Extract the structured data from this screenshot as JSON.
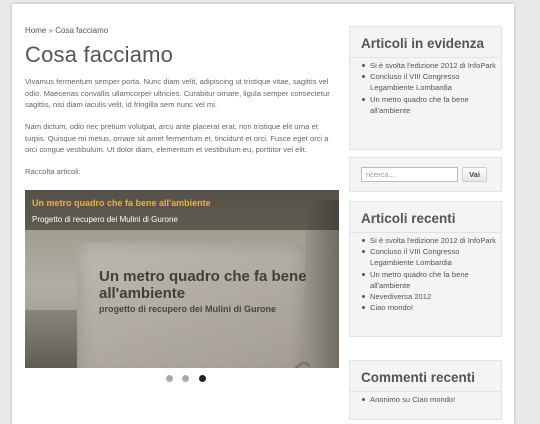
{
  "breadcrumb": {
    "home": "Home",
    "separator": "»",
    "current": "Cosa facciamo"
  },
  "main": {
    "title": "Cosa facciamo",
    "paragraphs": [
      "Vivamus fermentum semper porta. Nunc diam velit, adipiscing ut tristique vitae, sagittis vel odio. Maecenas convallis ullamcorper ultricies. Curabitur ornare, ligula semper consectetur sagittis, nisi diam iaculis velit, id fringilla sem nunc vel mi.",
      "Nam dictum, odio nec pretium volutpat, arcu ante placerat erat, non tristique elit urna et turpis. Quisque mi metus, ornare sit amet fermentum et, tincidunt et orci. Fusce eget orci a orci congue vestibulum. Ut dolor diam, elementum et vestibulum eu, porttitor vel elit.",
      "Raccolta articoli:"
    ]
  },
  "slider": {
    "slide_title": "Un metro quadro che fa bene all'ambiente",
    "slide_subtitle": "Progetto di recupero dei Mulini di Gurone",
    "image_text_title": "Un metro quadro che fa bene all'ambiente",
    "image_text_subtitle": "progetto di recupero dei Mulini di Gurone",
    "dots": [
      {
        "active": false
      },
      {
        "active": false
      },
      {
        "active": true
      }
    ],
    "accent_color": "#e8b43a"
  },
  "sidebar": {
    "featured": {
      "title": "Articoli in evidenza",
      "items": [
        "Si è svolta l'edizione 2012 di InfoPark",
        "Concluso il VIII Congresso Legambiente Lombardia",
        "Un metro quadro che fa bene all'ambiente"
      ]
    },
    "search": {
      "placeholder": "ricerca...",
      "button_label": "Vai"
    },
    "recent": {
      "title": "Articoli recenti",
      "items": [
        "Si è svolta l'edizione 2012 di InfoPark",
        "Concluso il VIII Congresso Legambiente Lombardia",
        "Un metro quadro che fa bene all'ambiente",
        "Nevediversa 2012",
        "Ciao mondo!"
      ]
    },
    "comments": {
      "title": "Commenti recenti",
      "items": [
        "Anonimo su Ciao mondo!"
      ]
    }
  }
}
